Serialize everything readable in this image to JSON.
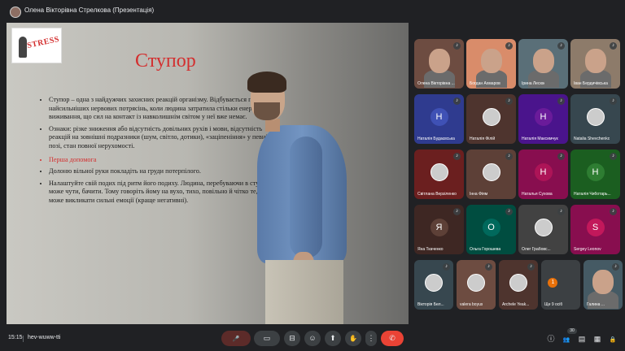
{
  "presenter": {
    "label": "Олена Вікторівна Стрелкова (Презентація)"
  },
  "slide": {
    "logo_text": "STRESS",
    "title": "Ступор",
    "bullets": [
      "Ступор – одна з найдужчих захисних реакцій організму. Відбувається після найсильніших нервових потрясінь, коли людина затратила стільки енергії на виживання, що сил на контакт із навколишнім світом у неї вже немає.",
      "Ознаки: різке зниження або відсутність довільних рухів і мови, відсутність реакцій на зовнішні подразники (шум, світло, дотики), «заціпеніння» у певній позі, стан повної нерухомості."
    ],
    "first_aid_label": "Перша допомога",
    "first_aid_items": [
      "Долоню вільної руки покладіть на груди потерпілого.",
      "Налаштуйте свій подих під ритм його подиху. Людина, перебуваючи в ступорі, може чути, бачити. Тому говоріть йому на вухо, тихо, повільно й чітко те, що може викликати сильні емоції (краще негативні)."
    ]
  },
  "participants": [
    {
      "name": "Олена Вікторівна ...",
      "kind": "video",
      "bg": "#6d4c41"
    },
    {
      "name": "Богдан Ахмаров",
      "kind": "video",
      "bg": "#d98c6a"
    },
    {
      "name": "Ірина Лесюк",
      "kind": "video",
      "bg": "#5a6f78"
    },
    {
      "name": "Іван Бердичівська",
      "kind": "video",
      "bg": "#8d7b6a"
    },
    {
      "name": "Наталія Будаєвська",
      "kind": "initial",
      "initial": "Н",
      "bg": "#2f3b8f",
      "circle": "#3f51b5"
    },
    {
      "name": "Наталія Філій",
      "kind": "pic",
      "bg": "#4e342e"
    },
    {
      "name": "Наталія Максимчук",
      "kind": "initial",
      "initial": "Н",
      "bg": "#4a148c",
      "circle": "#6a1b9a"
    },
    {
      "name": "Natalia Shevchenko",
      "kind": "pic",
      "bg": "#37474f"
    },
    {
      "name": "Світлана Верзіленко",
      "kind": "pic",
      "bg": "#6b1f1f"
    },
    {
      "name": "Інна Фіям",
      "kind": "pic",
      "bg": "#5d4037"
    },
    {
      "name": "Наталья Сухова",
      "kind": "initial",
      "initial": "Н",
      "bg": "#880e4f",
      "circle": "#ad1457"
    },
    {
      "name": "Наталія Чиботарь...",
      "kind": "initial",
      "initial": "Н",
      "bg": "#1b5e20",
      "circle": "#2e7d32"
    },
    {
      "name": "Яна Ткаченко",
      "kind": "initial",
      "initial": "Я",
      "bg": "#3e2723",
      "circle": "#5d4037"
    },
    {
      "name": "Ольга Горошева",
      "kind": "initial",
      "initial": "О",
      "bg": "#004d40",
      "circle": "#00695c"
    },
    {
      "name": "Олег Грабовс...",
      "kind": "pic",
      "bg": "#424242"
    },
    {
      "name": "Sergey Leonov",
      "kind": "initial",
      "initial": "S",
      "bg": "#880e4f",
      "circle": "#c2185b"
    },
    {
      "name": "Вікторія Бел...",
      "kind": "pic",
      "bg": "#37474f"
    },
    {
      "name": "valera boyus",
      "kind": "pic",
      "bg": "#6d4c41"
    },
    {
      "name": "Archele Yeak...",
      "kind": "pic",
      "bg": "#4e342e"
    },
    {
      "name": "Ще 9 осіб",
      "kind": "more",
      "bg": "#3c4043"
    },
    {
      "name": "Галина ...",
      "kind": "video",
      "bg": "#455a64"
    }
  ],
  "bottom": {
    "time": "15:15",
    "meeting_code": "hev-wuww-tti",
    "participants_count": "30"
  },
  "icons": {
    "mic_off": "🎤",
    "camera": "▭",
    "captions": "⊟",
    "emoji": "☺",
    "present": "⬆",
    "raise_hand": "✋",
    "more": "⋮",
    "end_call": "✆",
    "info": "ⓘ",
    "people": "👥",
    "chat": "▤",
    "activities": "▦",
    "host": "🔒"
  },
  "colors": {
    "end_call": "#ea4335",
    "mic_off": "#5c2b29",
    "title_red": "#d32f2f"
  }
}
